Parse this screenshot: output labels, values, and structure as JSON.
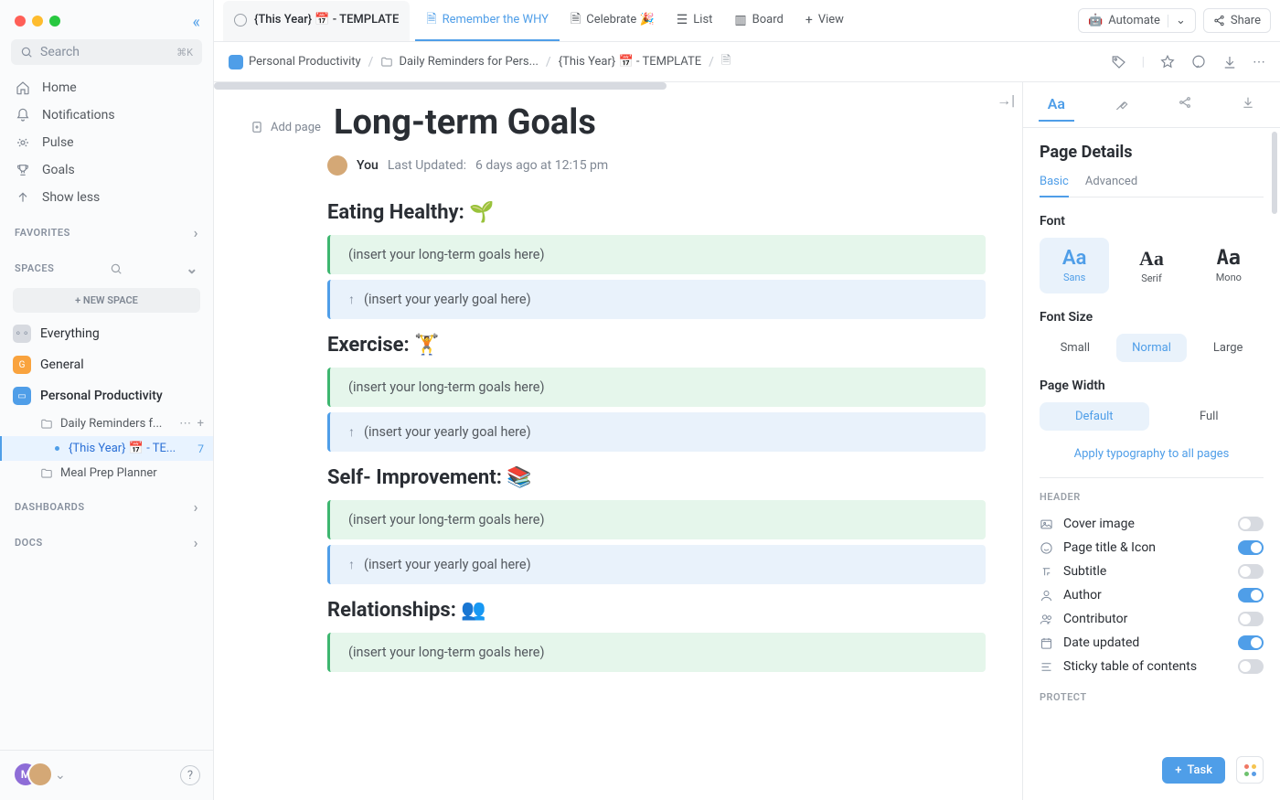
{
  "sidebar": {
    "search_placeholder": "Search",
    "shortcut": "⌘K",
    "nav": [
      {
        "label": "Home"
      },
      {
        "label": "Notifications"
      },
      {
        "label": "Pulse"
      },
      {
        "label": "Goals"
      },
      {
        "label": "Show less"
      }
    ],
    "favorites_label": "FAVORITES",
    "spaces_label": "SPACES",
    "new_space": "+ NEW SPACE",
    "spaces": [
      {
        "label": "Everything"
      },
      {
        "label": "General"
      },
      {
        "label": "Personal Productivity"
      }
    ],
    "children": [
      {
        "label": "Daily Reminders f..."
      },
      {
        "label": "{This Year} 📅 - TE...",
        "count": "7"
      },
      {
        "label": "Meal Prep Planner"
      }
    ],
    "dashboards_label": "DASHBOARDS",
    "docs_label": "DOCS"
  },
  "topbar": {
    "main": "{This Year} 📅 - TEMPLATE",
    "tabs": [
      {
        "label": "Remember the WHY"
      },
      {
        "label": "Celebrate 🎉"
      },
      {
        "label": "List"
      },
      {
        "label": "Board"
      },
      {
        "label": "View"
      }
    ],
    "automate": "Automate",
    "share": "Share"
  },
  "breadcrumb": {
    "a": "Personal Productivity",
    "b": "Daily Reminders for Pers...",
    "c": "{This Year} 📅 - TEMPLATE"
  },
  "doc": {
    "add_page": "Add page",
    "title": "Long-term Goals",
    "by_label": "You",
    "updated_label": "Last Updated:",
    "updated_value": "6 days ago at 12:15 pm",
    "longterm_placeholder": "(insert your long-term goals here)",
    "yearly_placeholder": "(insert your yearly goal here)",
    "sections": [
      {
        "heading": "Eating Healthy: 🌱"
      },
      {
        "heading": "Exercise: 🏋️"
      },
      {
        "heading": "Self- Improvement: 📚"
      },
      {
        "heading": "Relationships: 👥"
      }
    ]
  },
  "panel": {
    "title": "Page Details",
    "basic": "Basic",
    "advanced": "Advanced",
    "font_label": "Font",
    "fonts": [
      {
        "big": "Aa",
        "lbl": "Sans"
      },
      {
        "big": "Aa",
        "lbl": "Serif"
      },
      {
        "big": "Aa",
        "lbl": "Mono"
      }
    ],
    "fontsize_label": "Font Size",
    "sizes": [
      "Small",
      "Normal",
      "Large"
    ],
    "width_label": "Page Width",
    "widths": [
      "Default",
      "Full"
    ],
    "apply": "Apply typography to all pages",
    "header_cat": "HEADER",
    "toggles": [
      {
        "label": "Cover image",
        "on": false
      },
      {
        "label": "Page title & Icon",
        "on": true
      },
      {
        "label": "Subtitle",
        "on": false
      },
      {
        "label": "Author",
        "on": true
      },
      {
        "label": "Contributor",
        "on": false
      },
      {
        "label": "Date updated",
        "on": true
      },
      {
        "label": "Sticky table of contents",
        "on": false
      }
    ],
    "protect_cat": "PROTECT",
    "task_btn": "Task"
  }
}
